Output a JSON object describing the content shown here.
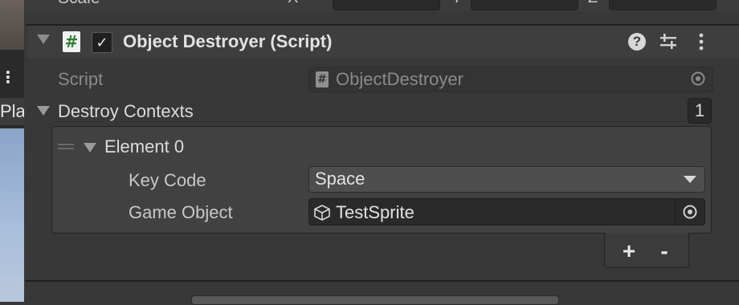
{
  "scene_view": {
    "tab_label": "Pla",
    "dots": "⋮"
  },
  "previous_component": {
    "label": "Scale",
    "axes": [
      "X",
      "Y",
      "Z"
    ]
  },
  "component": {
    "title": "Object Destroyer (Script)",
    "enabled_checkmark": "✓",
    "script_icon_glyph": "#",
    "help_glyph": "?",
    "icons": [
      "help-icon",
      "presets-icon",
      "menu-icon"
    ]
  },
  "script_row": {
    "label": "Script",
    "value": "ObjectDestroyer",
    "icon_glyph": "#"
  },
  "destroy_contexts": {
    "label": "Destroy Contexts",
    "size": "1",
    "element": {
      "label": "Element 0",
      "key_code_label": "Key Code",
      "key_code_value": "Space",
      "game_object_label": "Game Object",
      "game_object_value": "TestSprite"
    },
    "add_glyph": "+",
    "remove_glyph": "-"
  },
  "colors": {
    "background": "#383838",
    "header": "#3e3e3e",
    "field_dark": "#2a2a2a",
    "text": "#d2d2d2",
    "script_icon_green": "#2f7d32"
  }
}
